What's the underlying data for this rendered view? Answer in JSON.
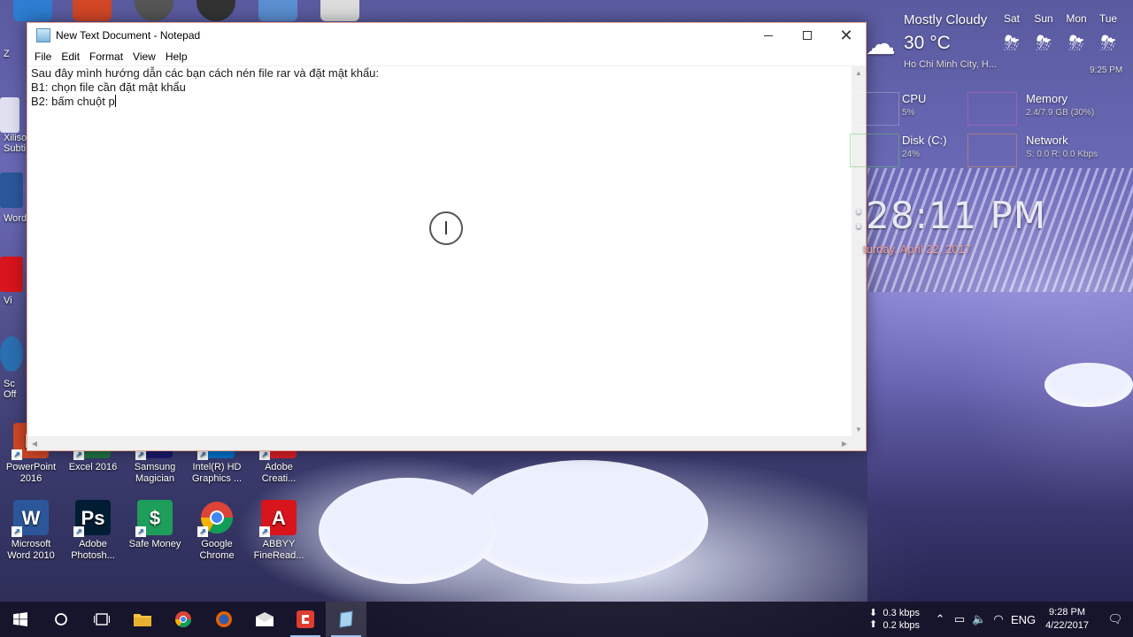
{
  "notepad": {
    "title": "New Text Document - Notepad",
    "menu": [
      "File",
      "Edit",
      "Format",
      "View",
      "Help"
    ],
    "lines": [
      "Sau đây mình hướng dẫn các bạn cách nén file rar và đặt mật khẩu:",
      "B1: chọn file cần đặt mật khẩu",
      "B2: bấm chuột p"
    ]
  },
  "desktop_icons": [
    {
      "label": "PowerPoint\n2016",
      "icon": "powerpoint-icon",
      "color": "#d24726",
      "glyph": "P"
    },
    {
      "label": "Excel 2016",
      "icon": "excel-icon",
      "color": "#207245",
      "glyph": "X"
    },
    {
      "label": "Samsung\nMagician",
      "icon": "samsung-magician-icon",
      "color": "#1a1a6e",
      "glyph": "S"
    },
    {
      "label": "Intel(R) HD\nGraphics ...",
      "icon": "intel-graphics-icon",
      "color": "#0071c5",
      "glyph": "i"
    },
    {
      "label": "Adobe\nCreati...",
      "icon": "adobe-creative-cloud-icon",
      "color": "#da1f26",
      "glyph": "Cc"
    },
    {
      "label": "Microsoft\nWord 2010",
      "icon": "word-icon",
      "color": "#2b579a",
      "glyph": "W"
    },
    {
      "label": "Adobe\nPhotosh...",
      "icon": "photoshop-icon",
      "color": "#001d34",
      "glyph": "Ps"
    },
    {
      "label": "Safe Money",
      "icon": "safe-money-icon",
      "color": "#1e9e5a",
      "glyph": "$"
    },
    {
      "label": "Google\nChrome",
      "icon": "chrome-icon",
      "color": "#ffffff",
      "glyph": ""
    },
    {
      "label": "ABBYY\nFineRead...",
      "icon": "abbyy-icon",
      "color": "#d8141c",
      "glyph": "A"
    }
  ],
  "edge_labels": [
    "Z",
    "Xiliso\nSubti",
    "Word",
    "Vi",
    "Sc\nOff"
  ],
  "weather": {
    "condition": "Mostly Cloudy",
    "temperature": "30 °C",
    "location": "Ho Chi Minh City, H...",
    "updated": "9:25 PM",
    "forecast_days": [
      "Sat",
      "Sun",
      "Mon",
      "Tue"
    ]
  },
  "performance": {
    "cpu": {
      "label": "CPU",
      "value": "5%"
    },
    "memory": {
      "label": "Memory",
      "value": "2.4/7.9 GB (30%)"
    },
    "disk": {
      "label": "Disk (C:)",
      "value": "24%"
    },
    "network": {
      "label": "Network",
      "value": "S: 0.0  R: 0.0 Kbps"
    }
  },
  "clock_widget": {
    "time": ":28:11 PM",
    "date": "turday, April 22, 2017"
  },
  "taskbar": {
    "net_up": "0.3 kbps",
    "net_down": "0.2 kbps",
    "language": "ENG",
    "time": "9:28 PM",
    "date": "4/22/2017"
  }
}
